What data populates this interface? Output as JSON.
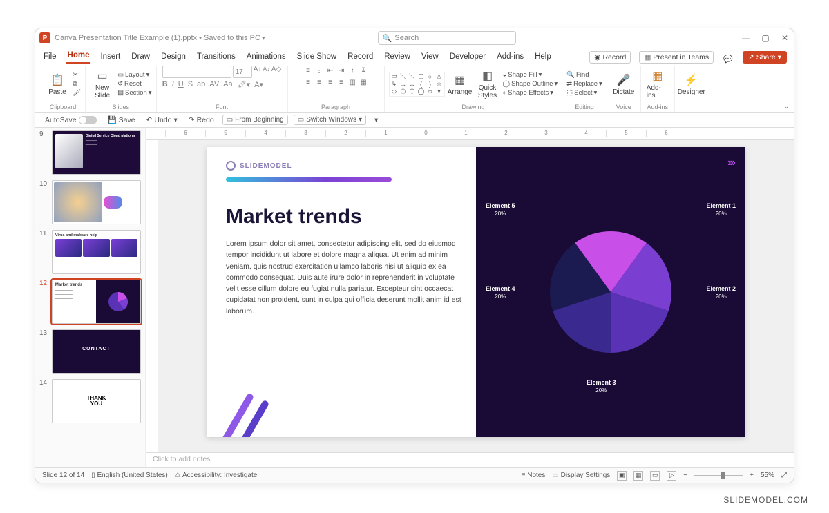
{
  "app": {
    "icon_letter": "P",
    "title": "Canva Presentation Title Example (1).pptx • Saved to this PC",
    "search_placeholder": "Search"
  },
  "window": {
    "min": "—",
    "max": "▢",
    "close": "✕"
  },
  "tabs": {
    "items": [
      "File",
      "Home",
      "Insert",
      "Draw",
      "Design",
      "Transitions",
      "Animations",
      "Slide Show",
      "Record",
      "Review",
      "View",
      "Developer",
      "Add-ins",
      "Help"
    ],
    "active": 1
  },
  "tabs_right": {
    "record": "Record",
    "present": "Present in Teams",
    "share": "Share"
  },
  "ribbon": {
    "clipboard": {
      "paste": "Paste",
      "label": "Clipboard"
    },
    "slides": {
      "new_slide": "New\nSlide",
      "layout": "Layout",
      "reset": "Reset",
      "section": "Section",
      "label": "Slides"
    },
    "font": {
      "size": "17",
      "bold": "B",
      "italic": "I",
      "underline": "U",
      "strike": "S",
      "shadow": "ab",
      "spacing": "AV",
      "case": "Aa",
      "label": "Font"
    },
    "paragraph": {
      "label": "Paragraph"
    },
    "drawing": {
      "arrange": "Arrange",
      "quick": "Quick\nStyles",
      "fill": "Shape Fill",
      "outline": "Shape Outline",
      "effects": "Shape Effects",
      "label": "Drawing"
    },
    "editing": {
      "find": "Find",
      "replace": "Replace",
      "select": "Select",
      "label": "Editing"
    },
    "voice": {
      "dictate": "Dictate",
      "label": "Voice"
    },
    "addins": {
      "addins": "Add-ins",
      "label": "Add-ins"
    },
    "designer": {
      "designer": "Designer"
    }
  },
  "qat": {
    "autosave": "AutoSave",
    "save": "Save",
    "undo": "Undo",
    "redo": "Redo",
    "from_beginning": "From Beginning",
    "switch_windows": "Switch Windows"
  },
  "thumbs": {
    "n9": "9",
    "t9_title": "Digital Service Cloud platform",
    "n10": "10",
    "n11": "11",
    "t11_title": "Virus and malware help",
    "n12": "12",
    "t12_title": "Market trends",
    "n13": "13",
    "t13_title": "CONTACT",
    "n14": "14",
    "t14_title": "THANK YOU"
  },
  "slide": {
    "logo": "SLIDEMODEL",
    "title": "Market trends",
    "body": "Lorem ipsum dolor sit amet, consectetur adipiscing elit, sed do eiusmod tempor incididunt ut labore et dolore magna aliqua. Ut enim ad minim veniam, quis nostrud exercitation ullamco laboris nisi ut aliquip ex ea commodo consequat. Duis aute irure dolor in reprehenderit in voluptate velit esse cillum dolore eu fugiat nulla pariatur. Excepteur sint occaecat cupidatat non proident, sunt in culpa qui officia deserunt mollit anim id est laborum.",
    "arrows": "›››"
  },
  "chart_data": {
    "type": "pie",
    "series": [
      {
        "name": "Element 1",
        "value": 20,
        "color": "#c84fe8"
      },
      {
        "name": "Element 2",
        "value": 20,
        "color": "#7a3fd0"
      },
      {
        "name": "Element 3",
        "value": 20,
        "color": "#5a32b5"
      },
      {
        "name": "Element 4",
        "value": 20,
        "color": "#3a2a8f"
      },
      {
        "name": "Element 5",
        "value": 20,
        "color": "#1b1b52"
      }
    ],
    "labels": {
      "e1": "Element\n1\n20%",
      "e2": "Element\n2\n20%",
      "e3": "Element\n3\n20%",
      "e4": "Element\n4\n20%",
      "e5": "Element\n5\n20%"
    }
  },
  "notes": {
    "placeholder": "Click to add notes"
  },
  "status": {
    "slide": "Slide 12 of 14",
    "lang": "English (United States)",
    "access": "Accessibility: Investigate",
    "notes": "Notes",
    "display": "Display Settings",
    "zoom": "55%"
  },
  "ruler": {
    "ticks": [
      "6",
      "5",
      "4",
      "3",
      "2",
      "1",
      "0",
      "1",
      "2",
      "3",
      "4",
      "5",
      "6"
    ]
  },
  "watermark": "SLIDEMODEL.COM"
}
